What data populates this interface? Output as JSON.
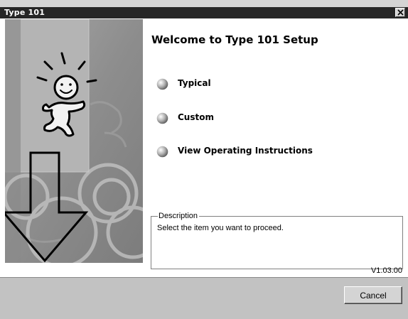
{
  "window": {
    "title": "Type 101",
    "close_icon": "close-icon"
  },
  "main": {
    "heading": "Welcome to Type 101 Setup",
    "options": [
      {
        "label": "Typical",
        "icon": "gray-ball-icon"
      },
      {
        "label": "Custom",
        "icon": "gray-ball-icon"
      },
      {
        "label": "View Operating Instructions",
        "icon": "gray-ball-icon"
      }
    ]
  },
  "description": {
    "legend": "Description",
    "text": "Select the item you want to proceed."
  },
  "version": "V1.03.00",
  "footer": {
    "cancel_label": "Cancel"
  }
}
